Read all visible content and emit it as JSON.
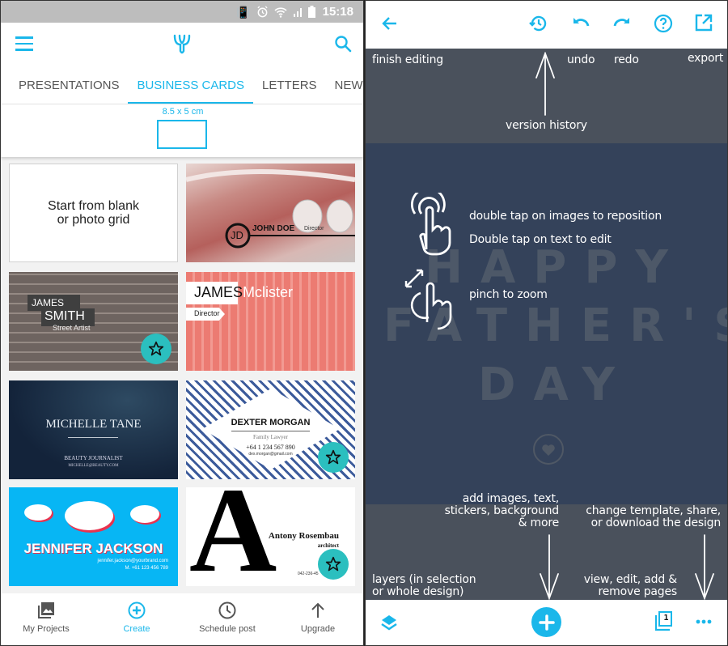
{
  "left": {
    "status_bar": {
      "icons": [
        "vibrate-icon",
        "alarm-icon",
        "wifi-icon",
        "signal-icon",
        "battery-icon"
      ],
      "time": "15:18"
    },
    "app_bar": {
      "menu_icon": "hamburger-menu-icon",
      "logo_icon": "app-logo-icon",
      "search_icon": "search-icon"
    },
    "tabs": [
      {
        "label": "PRESENTATIONS",
        "active": false
      },
      {
        "label": "BUSINESS CARDS",
        "active": true
      },
      {
        "label": "LETTERS",
        "active": false
      },
      {
        "label": "NEWSLETTERS",
        "active": false
      }
    ],
    "size": {
      "label": "8.5 x 5 cm"
    },
    "templates": {
      "blank": {
        "label_line1": "Start from blank",
        "label_line2": "or photo grid"
      },
      "cards": [
        {
          "name": "JOHN DOE",
          "title": "Director",
          "monogram": "JD",
          "premium": false
        },
        {
          "name_first": "JAMES",
          "name_last": "SMITH",
          "title": "Street Artist",
          "premium": true
        },
        {
          "name_first": "JAMES",
          "name_last": "Mclister",
          "title": "Director",
          "premium": false
        },
        {
          "name": "MICHELLE TANE",
          "title": "BEAUTY JOURNALIST",
          "email": "MICHELLE@BEAUTY.COM",
          "premium": false
        },
        {
          "name": "DEXTER MORGAN",
          "title": "Family Lawyer",
          "phone": "+64 1 234 567 890",
          "email": "dex.morgan@gmail.com",
          "premium": true
        },
        {
          "name": "JENNIFER JACKSON",
          "email": "jennifer.jackson@yourbrand.com",
          "phone": "M. +61 123 456 789",
          "premium": false
        },
        {
          "name": "Antony Rosembau",
          "title": "architect",
          "monogram": "A",
          "phone": "042-236-45",
          "premium": true
        }
      ]
    },
    "bottom_nav": [
      {
        "label": "My Projects",
        "icon": "photo-library-icon",
        "active": false
      },
      {
        "label": "Create",
        "icon": "add-circle-icon",
        "active": true
      },
      {
        "label": "Schedule post",
        "icon": "clock-icon",
        "active": false
      },
      {
        "label": "Upgrade",
        "icon": "arrow-up-icon",
        "active": false
      }
    ]
  },
  "right": {
    "toolbar": {
      "back_icon": "arrow-left-icon",
      "history_icon": "history-icon",
      "undo_icon": "undo-icon",
      "redo_icon": "redo-icon",
      "help_icon": "help-icon",
      "export_icon": "export-icon"
    },
    "annotations": {
      "finish_editing": "finish editing",
      "undo": "undo",
      "redo": "redo",
      "export": "export",
      "version_history": "version history",
      "double_tap_images": "double tap on images to reposition",
      "double_tap_text": "Double tap on text to edit",
      "pinch_zoom": "pinch to zoom",
      "add_line1": "add images, text,",
      "add_line2": "stickers, background",
      "add_line3": "& more",
      "change_line1": "change template, share,",
      "change_line2": "or download the design",
      "layers_line1": "layers (in selection",
      "layers_line2": "or whole design)",
      "pages_line1": "view, edit, add &",
      "pages_line2": "remove pages"
    },
    "design": {
      "line1": "HAPPY",
      "line2": "FATHER'S",
      "line3": "DAY"
    },
    "bottom_bar": {
      "layers_icon": "layers-icon",
      "add_icon": "add-icon",
      "pages_icon": "pages-icon",
      "page_count": "1",
      "more_icon": "more-horizontal-icon"
    },
    "colors": {
      "accent": "#1ab7ea",
      "canvas": "#34425a",
      "overlay": "#4a515c",
      "premium_badge": "#2bbfbf"
    }
  }
}
